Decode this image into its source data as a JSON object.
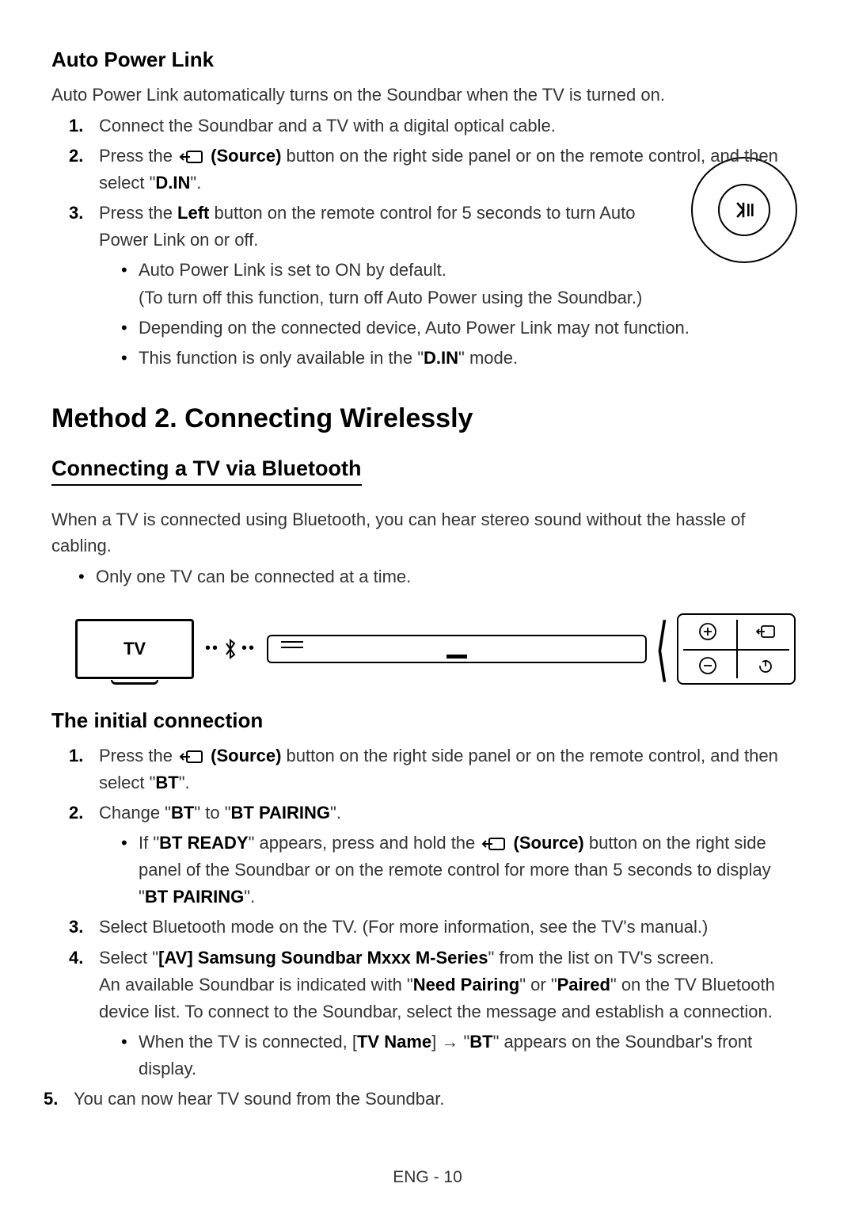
{
  "section1": {
    "heading": "Auto Power Link",
    "intro": "Auto Power Link automatically turns on the Soundbar when the TV is turned on.",
    "step1": "Connect the Soundbar and a TV with a digital optical cable.",
    "step2_a": "Press the ",
    "step2_src": " (Source)",
    "step2_b": " button on the right side panel or on the remote control, and then select \"",
    "step2_din": "D.IN",
    "step2_c": "\".",
    "step3_a": "Press the ",
    "step3_left": "Left",
    "step3_b": " button on the remote control for 5 seconds to turn Auto Power Link on or off.",
    "bullet1a": "Auto Power Link is set to ON by default.",
    "bullet1b": "(To turn off this function, turn off Auto Power using the Soundbar.)",
    "bullet2": "Depending on the connected device, Auto Power Link may not function.",
    "bullet3_a": "This function is only available in the \"",
    "bullet3_din": "D.IN",
    "bullet3_b": "\" mode."
  },
  "method2": {
    "heading": "Method 2. Connecting Wirelessly",
    "sub": "Connecting a TV via Bluetooth",
    "intro": "When a TV is connected using Bluetooth, you can hear stereo sound without the hassle of cabling.",
    "bullet": "Only one TV can be connected at a time.",
    "tv_label": "TV"
  },
  "initial": {
    "heading": "The initial connection",
    "s1_a": "Press the ",
    "s1_src": " (Source)",
    "s1_b": " button on the right side panel or on the remote control, and then select \"",
    "s1_bt": "BT",
    "s1_c": "\".",
    "s2_a": "Change \"",
    "s2_bt": "BT",
    "s2_b": "\" to \"",
    "s2_pair": "BT PAIRING",
    "s2_c": "\".",
    "s2_sub_a": "If \"",
    "s2_sub_ready": "BT READY",
    "s2_sub_b": "\" appears, press and hold the ",
    "s2_sub_src": " (Source)",
    "s2_sub_c": " button on the right side panel of the Soundbar or on the remote control for more than 5 seconds to display \"",
    "s2_sub_pair": "BT PAIRING",
    "s2_sub_d": "\".",
    "s3": "Select Bluetooth mode on the TV. (For more information, see the TV's manual.)",
    "s4_a": "Select \"",
    "s4_name": "[AV] Samsung Soundbar Mxxx M-Series",
    "s4_b": "\" from the list on TV's screen.",
    "s4_line2_a": "An available Soundbar is indicated with \"",
    "s4_need": "Need Pairing",
    "s4_line2_b": "\" or \"",
    "s4_paired": "Paired",
    "s4_line2_c": "\" on the TV Bluetooth device list. To connect to the Soundbar, select the message and establish a connection.",
    "s4_sub_a": "When the TV is connected, [",
    "s4_tvname": "TV Name",
    "s4_sub_b": "] → \"",
    "s4_sub_bt": "BT",
    "s4_sub_c": "\" appears on the Soundbar's front display.",
    "s5": "You can now hear TV sound from the Soundbar."
  },
  "footer": "ENG - 10"
}
